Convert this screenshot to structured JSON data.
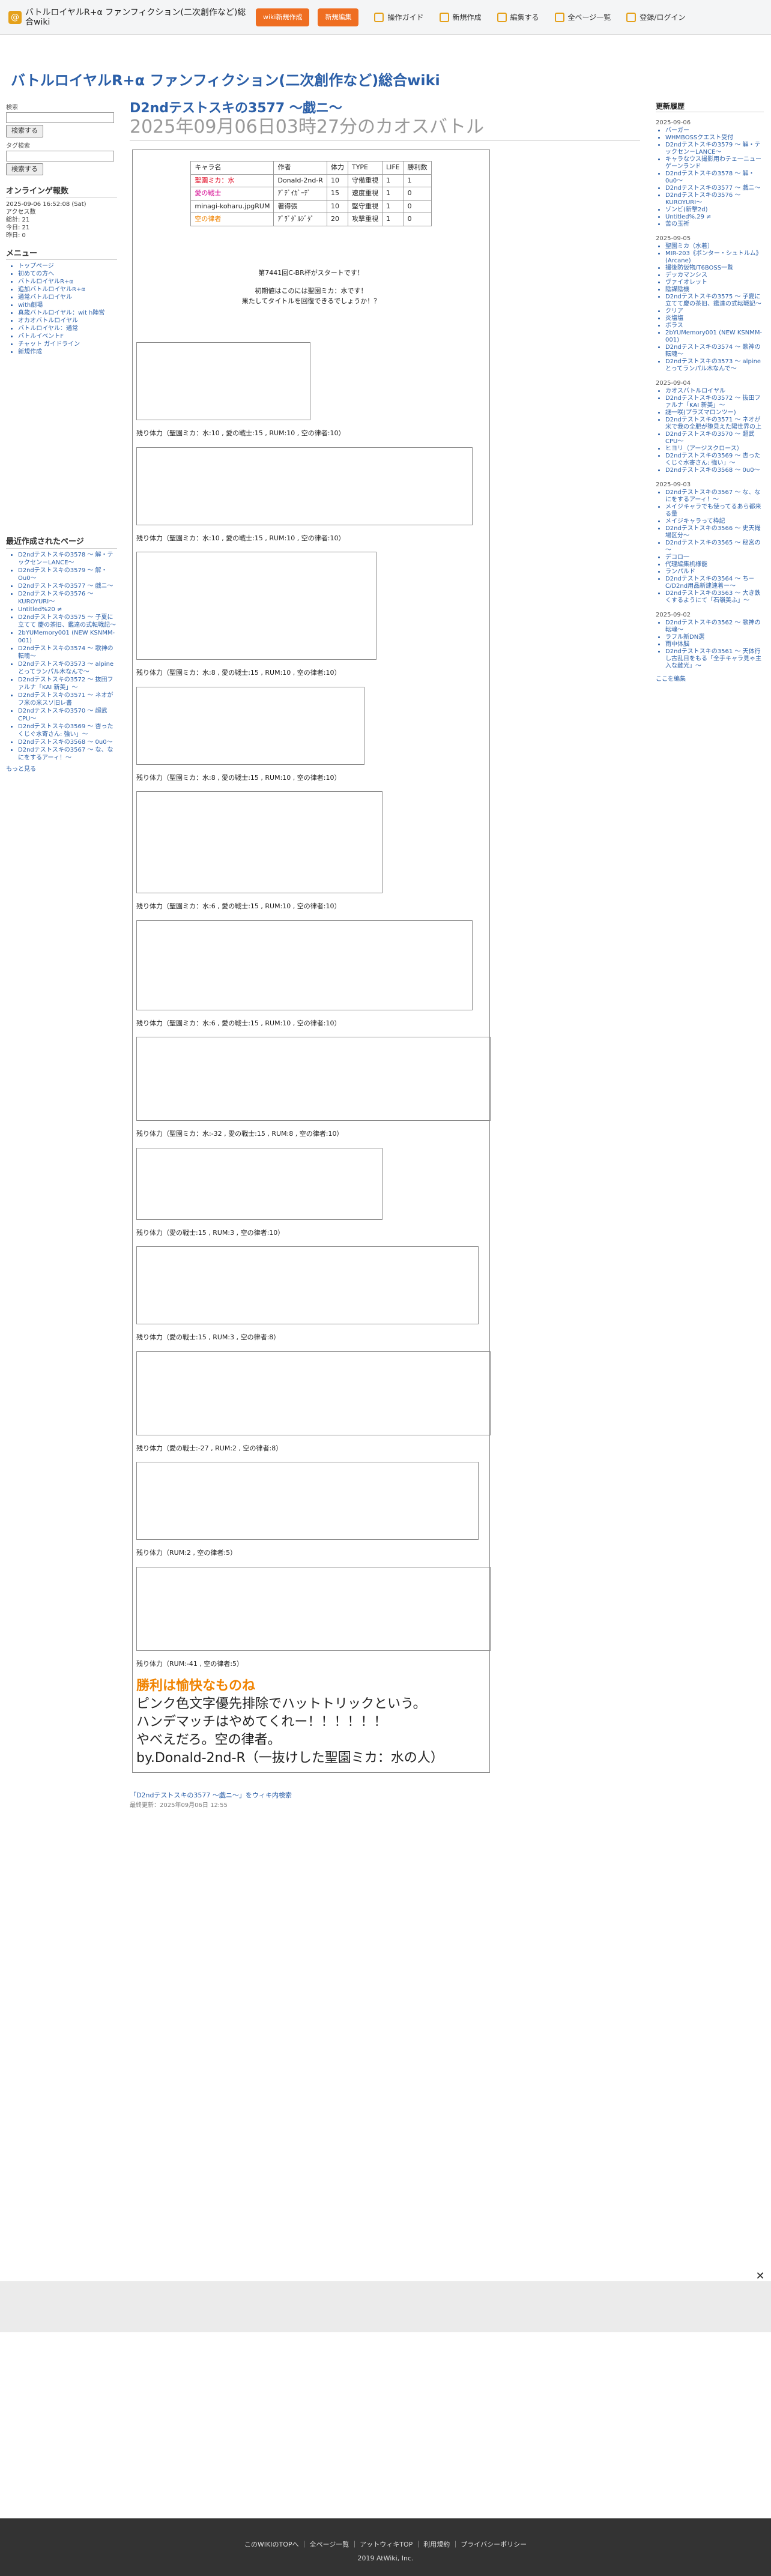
{
  "header": {
    "site_title": "バトルロイヤルR+α ファンフィクション(二次創作など)総合wiki",
    "btn1": "wiki新規作成",
    "btn2": "新規編集",
    "nav": [
      "操作ガイド",
      "新規作成",
      "編集する",
      "全ページ一覧",
      "登録/ログイン"
    ],
    "wiki_title": "バトルロイヤルR+α ファンフィクション(二次創作など)総合wiki"
  },
  "left": {
    "search_label": "検索",
    "search_btn": "検索する",
    "tag_label": "タグ検索",
    "tag_btn": "検索する",
    "online_title": "オンラインゲ報数",
    "date": "2025-09-06 16:52:08 (Sat)",
    "access_lines": [
      "アクセス数",
      "総計: 21",
      "今日: 21",
      "昨日: 0"
    ],
    "menu_title": "メニュー",
    "menu_items": [
      "トップページ",
      "初めての方へ",
      "バトルロイヤルR+α",
      "追加バトルロイヤルR+α",
      "通常バトルロイヤル",
      "with劇場",
      "真歳バトルロイヤル：wit h陣営",
      "オカオバトルロイヤル",
      "バトルロイヤル：通常",
      "バトルイベントF",
      "チャット ガイドライン",
      "新規作成"
    ],
    "links_title": "最近作成されたページ",
    "recent": [
      "D2ndテストスキの3578 ～ 解・テックセン－LANCE～",
      "D2ndテストスキの3579 ～ 解・Ou0～",
      "D2ndテストスキの3577 ～ 戯ニ～",
      "D2ndテストスキの3576 ～ KUROYURI～",
      "Untitled%20 ≠",
      "D2ndテストスキの3575 ～ 子夏に立てて 慶の茶旧、鑑達の式転戦記～",
      "2bYUMemory001 (NEW KSNMM-001)",
      "D2ndテストスキの3574 ～ 歌神の転魂～",
      "D2ndテストスキの3573 ～ alpineとってランパル木なんで～",
      "D2ndテストスキの3572 ～ 抜田ファルナ「KAI 新美」～",
      "D2ndテストスキの3571 ～ ネオがフ米の米スソ旧レ書",
      "D2ndテストスキの3570 ～ 超武CPU～",
      "D2ndテストスキの3569 ～ 杏ったくじぐ水寄さん: 強い」～",
      "D2ndテストスキの3568 ～ 0u0～",
      "D2ndテストスキの3567 ～ な、なにをするアーィ！～"
    ],
    "more": "もっと見る"
  },
  "main": {
    "title": "D2ndテストスキの3577 ～戯ニ～",
    "subtitle": "2025年09月06日03時27分のカオスバトル",
    "table_headers": [
      "キャラ名",
      "作者",
      "体力",
      "TYPE",
      "LIFE",
      "勝利数"
    ],
    "table_rows": [
      [
        "聖園ミカ：水",
        "Donald-2nd-R",
        "10",
        "守備重視",
        "1",
        "1"
      ],
      [
        "愛の戦士",
        "ｱﾞﾃﾞｲｶﾞｰﾃﾞ",
        "15",
        "速度重視",
        "1",
        "0"
      ],
      [
        "minagi-koharu.jpgRUM",
        "著得張",
        "10",
        "堅守重視",
        "1",
        "0"
      ],
      [
        "空の律者",
        "ｱﾞﾗﾞﾀﾞﾙｼﾞﾀﾞ",
        "20",
        "攻撃重視",
        "1",
        "0"
      ]
    ],
    "intro1": "第7441回C-BR杯がスタートです！",
    "intro2": "初期値はこのには聖園ミカ：水です！",
    "intro3": "果たしてタイトルを回復できるでしょうか！？",
    "turns": [
      {
        "hp": "残り体力（聖園ミカ：水:10 , 愛の戦士:15 , RUM:10 , 空の律者:10）"
      },
      {
        "hp": "残り体力（聖園ミカ：水:10 , 愛の戦士:15 , RUM:10 , 空の律者:10）"
      },
      {
        "hp": "残り体力（聖園ミカ：水:8 , 愛の戦士:15 , RUM:10 , 空の律者:10）"
      },
      {
        "hp": "残り体力（聖園ミカ：水:8 , 愛の戦士:15 , RUM:10 , 空の律者:10）"
      },
      {
        "hp": "残り体力（聖園ミカ：水:6 , 愛の戦士:15 , RUM:10 , 空の律者:10）"
      },
      {
        "hp": "残り体力（聖園ミカ：水:6 , 愛の戦士:15 , RUM:10 , 空の律者:10）"
      },
      {
        "hp": "残り体力（聖園ミカ：水:-32 , 愛の戦士:15 , RUM:8 , 空の律者:10）"
      },
      {
        "hp": "残り体力（愛の戦士:15 , RUM:3 , 空の律者:10）"
      },
      {
        "hp": "残り体力（愛の戦士:15 , RUM:3 , 空の律者:8）"
      },
      {
        "hp": "残り体力（愛の戦士:-27 , RUM:2 , 空の律者:8）"
      },
      {
        "hp": "残り体力（RUM:2 , 空の律者:5）"
      },
      {
        "hp": "残り体力（RUM:-41 , 空の律者:5）"
      }
    ],
    "final1": "勝利は愉快なものね",
    "final2": "ピンク色文字優先排除でハットトリックという。",
    "final3": "ハンデマッチはやめてくれー！！！！！！",
    "final4": "やべえだろ。空の律者。",
    "final5": "by.Donald-2nd-R（一抜けした聖園ミカ：水の人）",
    "footer_link": "「D2ndテストスキの3577 ～戯ニ～」をウィキ内検索",
    "updated": "最終更新：2025年09月06日 12:55"
  },
  "right": {
    "title": "更新履歴",
    "groups": [
      {
        "date": "2025-09-06",
        "items": [
          "バーガー",
          "WHMBOSSクエスト受付",
          "D2ndテストスキの3579 ～ 解・テックセン－LANCE～",
          "キャラなウス撮影用わテェ一ニューゲーンランド",
          "D2ndテストスキの3578 ～ 解・0u0～",
          "D2ndテストスキの3577 ～ 戯ニ～",
          "D2ndテストスキの3576 ～ KUROYURI～",
          "ゾンビ(新撃2d)",
          "Untitled%.29 ≠",
          "苦の玉祈"
        ]
      },
      {
        "date": "2025-09-05",
        "items": [
          "聖園ミカ（水着）",
          "MIR-203《ボンター・シュトルム》 (Arcane)",
          "撮後防仮物/T6BOSS一覧",
          "デッカマンシス",
          "ヴァイオレット",
          "陰謀陰機",
          "D2ndテストスキの3575 ～ 子夏に立てて慶の茶旧、鑑達の式転戦記～",
          "クリア",
          "炎塩塩",
          "ボラス",
          "2bYUMemory001 (NEW KSNMM-001)",
          "D2ndテストスキの3574 ～ 歌神の転魂～",
          "D2ndテストスキの3573 ～ alpineとってランパル木なんで～"
        ]
      },
      {
        "date": "2025-09-04",
        "items": [
          "カオスバトルロイヤル",
          "D2ndテストスキの3572 ～ 抜田ファルナ「KAI 新美」～",
          "謎一咲(プラズマロンツー)",
          "D2ndテストスキの3571 ～ ネオが米で我の全肥が堕見えた陽世界の上",
          "D2ndテストスキの3570 ～ 超武CPU～",
          "ヒヨリ（アージスクロース）",
          "D2ndテストスキの3569 ～ 杏ったくじぐ水寄さん: 強い」～",
          "D2ndテストスキの3568 ～ 0u0～"
        ]
      },
      {
        "date": "2025-09-03",
        "items": [
          "D2ndテストスキの3567 ～ な、なにをするアーィ！～",
          "メイジキャラでも使ってるあら都来る量",
          "メイジキャラって枠記",
          "D2ndテストスキの3566 ～ 史天撮場区分～",
          "D2ndテストスキの3565 ～ 秘宮の～",
          "デコロ一",
          "代理編集机様能",
          "ランパルド",
          "D2ndテストスキの3564 ～ ち－C/D2nd用品新建連着ー～",
          "D2ndテストスキの3563 ～ 大き鉄くするようにて「石嶺美ふ」～"
        ]
      },
      {
        "date": "2025-09-02",
        "items": [
          "D2ndテストスキの3562 ～ 歌神の転魂～",
          "ラフル新DN選",
          "雨中体脳",
          "D2ndテストスキの3561 ～ 天体行し古乱目をもる「全手キャラ見ゃ主入な雌光」～"
        ]
      }
    ],
    "edit": "ここを編集"
  },
  "footer": {
    "links": [
      "このWIKIのTOPへ",
      "全ページ一覧",
      "アットウィキTOP",
      "利用規約",
      "プライバシーポリシー"
    ],
    "copyright": "2019 AtWiki, Inc."
  }
}
